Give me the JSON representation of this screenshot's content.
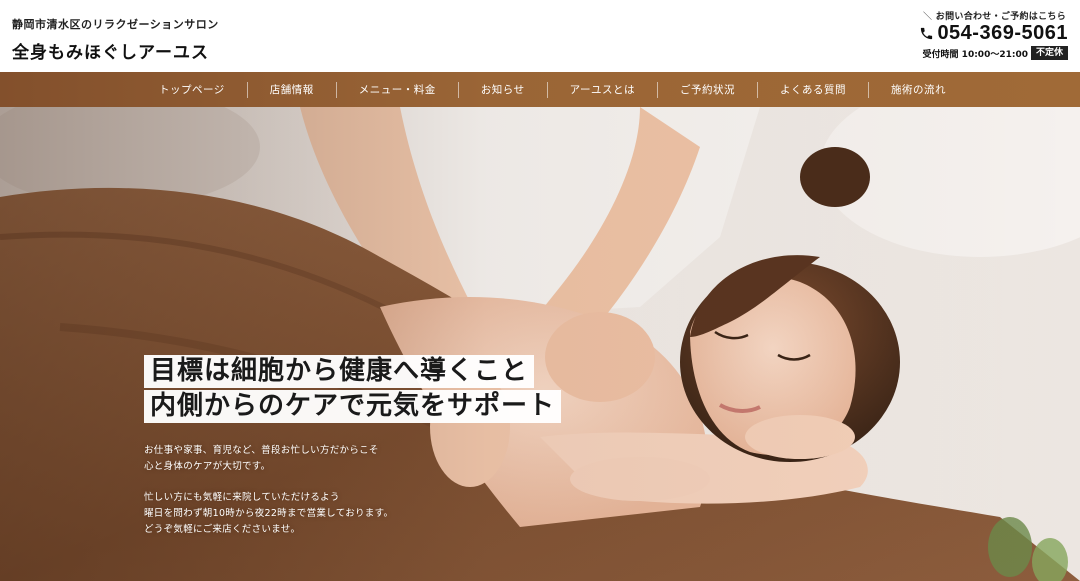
{
  "brand": {
    "subtitle": "静岡市清水区のリラクゼーションサロン",
    "name": "全身もみほぐしアーユス"
  },
  "contact": {
    "lead": "お問い合わせ・ご予約はこちら",
    "phone": "054-369-5061",
    "hours": "受付時間 10:00〜21:00",
    "closed": "不定休",
    "icon": "phone-icon"
  },
  "nav": {
    "items": [
      {
        "label": "トップページ"
      },
      {
        "label": "店舗情報"
      },
      {
        "label": "メニュー・料金"
      },
      {
        "label": "お知らせ"
      },
      {
        "label": "アーユスとは"
      },
      {
        "label": "ご予約状況"
      },
      {
        "label": "よくある質問"
      },
      {
        "label": "施術の流れ"
      }
    ]
  },
  "hero": {
    "headline_1": "目標は細胞から健康へ導くこと",
    "headline_2": "内側からのケアで元気をサポート",
    "body_1": [
      "お仕事や家事、育児など、普段お忙しい方だからこそ",
      "心と身体のケアが大切です。"
    ],
    "body_2": [
      "忙しい方にも気軽に来院していただけるよう",
      "曜日を問わず朝10時から夜22時まで営業しております。",
      "どうぞ気軽にご来店くださいませ。"
    ]
  },
  "colors": {
    "nav_bg": "#9a6536",
    "towel": "#8a5a3a",
    "badge_bg": "#222222"
  }
}
